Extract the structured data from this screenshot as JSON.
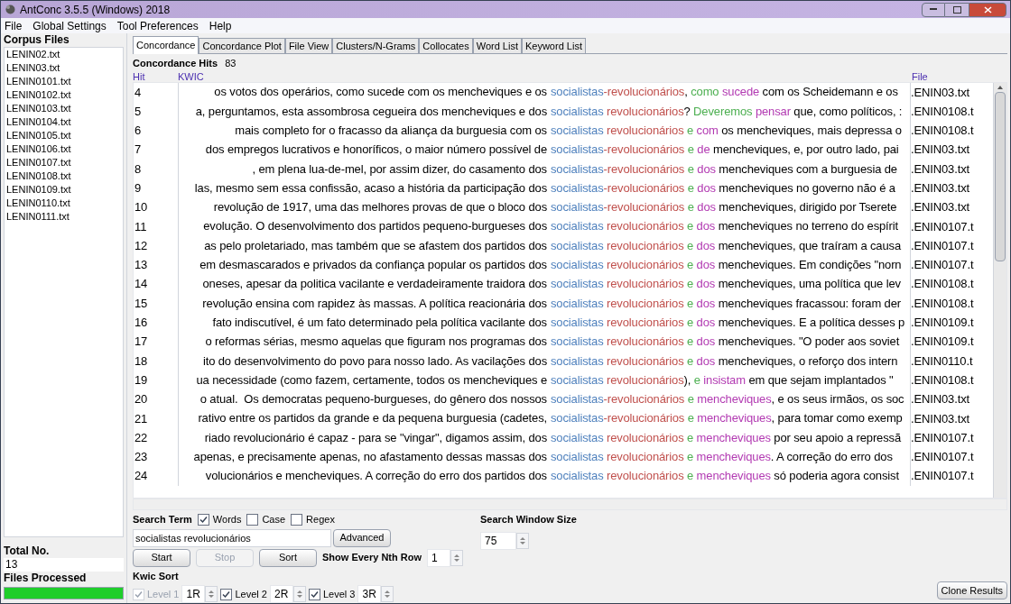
{
  "window": {
    "title": "AntConc 3.5.5 (Windows) 2018"
  },
  "menu": [
    "File",
    "Global Settings",
    "Tool Preferences",
    "Help"
  ],
  "sidebar": {
    "heading": "Corpus Files",
    "files": [
      "LENIN02.txt",
      "LENIN03.txt",
      "LENIN0101.txt",
      "LENIN0102.txt",
      "LENIN0103.txt",
      "LENIN0104.txt",
      "LENIN0105.txt",
      "LENIN0106.txt",
      "LENIN0107.txt",
      "LENIN0108.txt",
      "LENIN0109.txt",
      "LENIN0110.txt",
      "LENIN0111.txt"
    ],
    "total_label": "Total No.",
    "total": "13",
    "processed_label": "Files Processed",
    "progress": {
      "level": 1
    }
  },
  "tabs": [
    {
      "label": "Concordance",
      "selected": true
    },
    {
      "label": "Concordance Plot",
      "selected": false
    },
    {
      "label": "File View",
      "selected": false
    },
    {
      "label": "Clusters/N-Grams",
      "selected": false
    },
    {
      "label": "Collocates",
      "selected": false
    },
    {
      "label": "Word List",
      "selected": false
    },
    {
      "label": "Keyword List",
      "selected": false
    }
  ],
  "hits_label": "Concordance Hits",
  "hits": "83",
  "columns": {
    "hit": "Hit",
    "kwic": "KWIC",
    "file": "File"
  },
  "rows": [
    {
      "hit": "4",
      "left": "os votos dos operários, como sucede com os mencheviques e os",
      "right": [
        {
          "text": "socialistas",
          "color": "#4f81bd"
        },
        {
          "text": "-revolucionários",
          "color": "#c0504d"
        },
        {
          "text": ","
        },
        {
          "text": " como",
          "color": "#4caf50"
        },
        {
          "text": " sucede",
          "color": "#b23ab2"
        },
        {
          "text": " com os Scheidemann e os"
        }
      ],
      "file": ".ENIN03.txt"
    },
    {
      "hit": "5",
      "left": "a, perguntamos, esta assombrosa cegueira dos mencheviques e dos",
      "right": [
        {
          "text": "socialistas",
          "color": "#4f81bd"
        },
        {
          "text": " revolucionários",
          "color": "#c0504d"
        },
        {
          "text": "?"
        },
        {
          "text": " Deveremos",
          "color": "#4caf50"
        },
        {
          "text": " pensar",
          "color": "#b23ab2"
        },
        {
          "text": " que, como políticos, :"
        }
      ],
      "file": ".ENIN0108.t"
    },
    {
      "hit": "6",
      "left": "mais completo for o fracasso da aliança da burguesia com os",
      "right": [
        {
          "text": "socialistas",
          "color": "#4f81bd"
        },
        {
          "text": " revolucionários",
          "color": "#c0504d"
        },
        {
          "text": " e",
          "color": "#4caf50"
        },
        {
          "text": " com",
          "color": "#b23ab2"
        },
        {
          "text": " os mencheviques, mais depressa o"
        }
      ],
      "file": ".ENIN0108.t"
    },
    {
      "hit": "7",
      "left": "dos empregos lucrativos e honoríficos, o maior número possível de",
      "right": [
        {
          "text": "socialistas",
          "color": "#4f81bd"
        },
        {
          "text": "-revolucionários",
          "color": "#c0504d"
        },
        {
          "text": " e",
          "color": "#4caf50"
        },
        {
          "text": " de",
          "color": "#b23ab2"
        },
        {
          "text": " mencheviques, e, por outro lado, pai"
        }
      ],
      "file": ".ENIN03.txt"
    },
    {
      "hit": "8",
      "left": ", em plena lua-de-mel, por assim dizer, do casamento dos",
      "right": [
        {
          "text": "socialistas",
          "color": "#4f81bd"
        },
        {
          "text": "-revolucionários",
          "color": "#c0504d"
        },
        {
          "text": " e",
          "color": "#4caf50"
        },
        {
          "text": " dos",
          "color": "#b23ab2"
        },
        {
          "text": " mencheviques com a burguesia de"
        }
      ],
      "file": ".ENIN03.txt"
    },
    {
      "hit": "9",
      "left": "las, mesmo sem essa confissão, acaso a história da participação dos",
      "right": [
        {
          "text": "socialistas",
          "color": "#4f81bd"
        },
        {
          "text": "-revolucionários",
          "color": "#c0504d"
        },
        {
          "text": " e",
          "color": "#4caf50"
        },
        {
          "text": " dos",
          "color": "#b23ab2"
        },
        {
          "text": " mencheviques no governo não é a"
        }
      ],
      "file": ".ENIN03.txt"
    },
    {
      "hit": "10",
      "left": "revolução de 1917, uma das melhores provas de que o bloco dos",
      "right": [
        {
          "text": "socialistas",
          "color": "#4f81bd"
        },
        {
          "text": "-revolucionários",
          "color": "#c0504d"
        },
        {
          "text": " e",
          "color": "#4caf50"
        },
        {
          "text": " dos",
          "color": "#b23ab2"
        },
        {
          "text": " mencheviques, dirigido por Tserete"
        }
      ],
      "file": ".ENIN03.txt"
    },
    {
      "hit": "11",
      "left": "evolução. O desenvolvimento dos partidos pequeno-burgueses dos",
      "right": [
        {
          "text": "socialistas",
          "color": "#4f81bd"
        },
        {
          "text": " revolucionários",
          "color": "#c0504d"
        },
        {
          "text": " e",
          "color": "#4caf50"
        },
        {
          "text": " dos",
          "color": "#b23ab2"
        },
        {
          "text": " mencheviques no terreno do espírit"
        }
      ],
      "file": ".ENIN0107.t"
    },
    {
      "hit": "12",
      "left": "as pelo proletariado, mas também que se afastem dos partidos dos",
      "right": [
        {
          "text": "socialistas",
          "color": "#4f81bd"
        },
        {
          "text": " revolucionários",
          "color": "#c0504d"
        },
        {
          "text": " e",
          "color": "#4caf50"
        },
        {
          "text": " dos",
          "color": "#b23ab2"
        },
        {
          "text": " mencheviques, que traíram a causa"
        }
      ],
      "file": ".ENIN0107.t"
    },
    {
      "hit": "13",
      "left": "em desmascarados e privados da confiança popular os partidos dos",
      "right": [
        {
          "text": "socialistas",
          "color": "#4f81bd"
        },
        {
          "text": " revolucionários",
          "color": "#c0504d"
        },
        {
          "text": " e",
          "color": "#4caf50"
        },
        {
          "text": " dos",
          "color": "#b23ab2"
        },
        {
          "text": " mencheviques. Em condições \"norn"
        }
      ],
      "file": ".ENIN0107.t"
    },
    {
      "hit": "14",
      "left": "oneses, apesar da politica vacilante e verdadeiramente traidora dos",
      "right": [
        {
          "text": "socialistas",
          "color": "#4f81bd"
        },
        {
          "text": " revolucionários",
          "color": "#c0504d"
        },
        {
          "text": " e",
          "color": "#4caf50"
        },
        {
          "text": " dos",
          "color": "#b23ab2"
        },
        {
          "text": " mencheviques, uma política que lev"
        }
      ],
      "file": ".ENIN0108.t"
    },
    {
      "hit": "15",
      "left": "revolução ensina com rapidez às massas. A política reacionária dos",
      "right": [
        {
          "text": "socialistas",
          "color": "#4f81bd"
        },
        {
          "text": " revolucionários",
          "color": "#c0504d"
        },
        {
          "text": " e",
          "color": "#4caf50"
        },
        {
          "text": " dos",
          "color": "#b23ab2"
        },
        {
          "text": " mencheviques fracassou: foram der"
        }
      ],
      "file": ".ENIN0108.t"
    },
    {
      "hit": "16",
      "left": "fato indiscutível, é um fato determinado pela política vacilante dos",
      "right": [
        {
          "text": "socialistas",
          "color": "#4f81bd"
        },
        {
          "text": " revolucionários",
          "color": "#c0504d"
        },
        {
          "text": " e",
          "color": "#4caf50"
        },
        {
          "text": " dos",
          "color": "#b23ab2"
        },
        {
          "text": " mencheviques. E a política desses p"
        }
      ],
      "file": ".ENIN0109.t"
    },
    {
      "hit": "17",
      "left": "o reformas sérias, mesmo aquelas que figuram nos programas dos",
      "right": [
        {
          "text": "socialistas",
          "color": "#4f81bd"
        },
        {
          "text": " revolucionários",
          "color": "#c0504d"
        },
        {
          "text": " e",
          "color": "#4caf50"
        },
        {
          "text": " dos",
          "color": "#b23ab2"
        },
        {
          "text": " mencheviques. \"O poder aos soviet"
        }
      ],
      "file": ".ENIN0109.t"
    },
    {
      "hit": "18",
      "left": "ito do desenvolvimento do povo para nosso lado. As vacilações dos",
      "right": [
        {
          "text": "socialistas",
          "color": "#4f81bd"
        },
        {
          "text": " revolucionários",
          "color": "#c0504d"
        },
        {
          "text": " e",
          "color": "#4caf50"
        },
        {
          "text": " dos",
          "color": "#b23ab2"
        },
        {
          "text": " mencheviques, o reforço dos intern"
        }
      ],
      "file": ".ENIN0110.t"
    },
    {
      "hit": "19",
      "left": "ua necessidade (como fazem, certamente, todos os mencheviques e",
      "right": [
        {
          "text": "socialistas",
          "color": "#4f81bd"
        },
        {
          "text": " revolucionários",
          "color": "#c0504d"
        },
        {
          "text": "),"
        },
        {
          "text": " e",
          "color": "#4caf50"
        },
        {
          "text": " insistam",
          "color": "#b23ab2"
        },
        {
          "text": " em que sejam implantados \""
        }
      ],
      "file": ".ENIN0108.t"
    },
    {
      "hit": "20",
      "left": "o atual.  Os democratas pequeno-burgueses, do gênero dos nossos",
      "right": [
        {
          "text": "socialistas",
          "color": "#4f81bd"
        },
        {
          "text": "-revolucionários",
          "color": "#c0504d"
        },
        {
          "text": " e",
          "color": "#4caf50"
        },
        {
          "text": " mencheviques",
          "color": "#b23ab2"
        },
        {
          "text": ", e os seus irmãos, os soc"
        }
      ],
      "file": ".ENIN03.txt"
    },
    {
      "hit": "21",
      "left": "rativo entre os partidos da grande e da pequena burguesia (cadetes,",
      "right": [
        {
          "text": "socialistas",
          "color": "#4f81bd"
        },
        {
          "text": "-revolucionários",
          "color": "#c0504d"
        },
        {
          "text": " e",
          "color": "#4caf50"
        },
        {
          "text": " mencheviques",
          "color": "#b23ab2"
        },
        {
          "text": ", para tomar como exemp"
        }
      ],
      "file": ".ENIN03.txt"
    },
    {
      "hit": "22",
      "left": "riado revolucionário é capaz - para se \"vingar\", digamos assim, dos",
      "right": [
        {
          "text": "socialistas",
          "color": "#4f81bd"
        },
        {
          "text": " revolucionários",
          "color": "#c0504d"
        },
        {
          "text": " e",
          "color": "#4caf50"
        },
        {
          "text": " mencheviques",
          "color": "#b23ab2"
        },
        {
          "text": " por seu apoio a repressã"
        }
      ],
      "file": ".ENIN0107.t"
    },
    {
      "hit": "23",
      "left": "apenas, e precisamente apenas, no afastamento dessas massas dos",
      "right": [
        {
          "text": "socialistas",
          "color": "#4f81bd"
        },
        {
          "text": " revolucionários",
          "color": "#c0504d"
        },
        {
          "text": " e",
          "color": "#4caf50"
        },
        {
          "text": " mencheviques",
          "color": "#b23ab2"
        },
        {
          "text": ". A correção do erro dos"
        }
      ],
      "file": ".ENIN0107.t"
    },
    {
      "hit": "24",
      "left": "volucionários e mencheviques. A correção do erro dos partidos dos",
      "right": [
        {
          "text": "socialistas",
          "color": "#4f81bd"
        },
        {
          "text": " revolucionários",
          "color": "#c0504d"
        },
        {
          "text": " e",
          "color": "#4caf50"
        },
        {
          "text": " mencheviques",
          "color": "#b23ab2"
        },
        {
          "text": " só poderia agora consist"
        }
      ],
      "file": ".ENIN0107.t"
    }
  ],
  "search": {
    "label": "Search Term",
    "options": [
      {
        "label": "Words",
        "checked": true
      },
      {
        "label": "Case",
        "checked": false
      },
      {
        "label": "Regex",
        "checked": false
      }
    ],
    "value": "socialistas revolucionários",
    "advanced": "Advanced"
  },
  "window_size": {
    "label": "Search Window Size",
    "value": "75"
  },
  "buttons": [
    {
      "label": "Start",
      "disabled": false
    },
    {
      "label": "Stop",
      "disabled": true
    },
    {
      "label": "Sort",
      "disabled": false
    }
  ],
  "nth_row": {
    "label": "Show Every Nth Row",
    "value": "1"
  },
  "kwic_sort": {
    "label": "Kwic Sort",
    "levels": [
      {
        "label": "Level 1",
        "checked": true,
        "disabled": true,
        "value": "1R"
      },
      {
        "label": "Level 2",
        "checked": true,
        "disabled": false,
        "value": "2R"
      },
      {
        "label": "Level 3",
        "checked": true,
        "disabled": false,
        "value": "3R"
      }
    ]
  },
  "clone": "Clone Results"
}
